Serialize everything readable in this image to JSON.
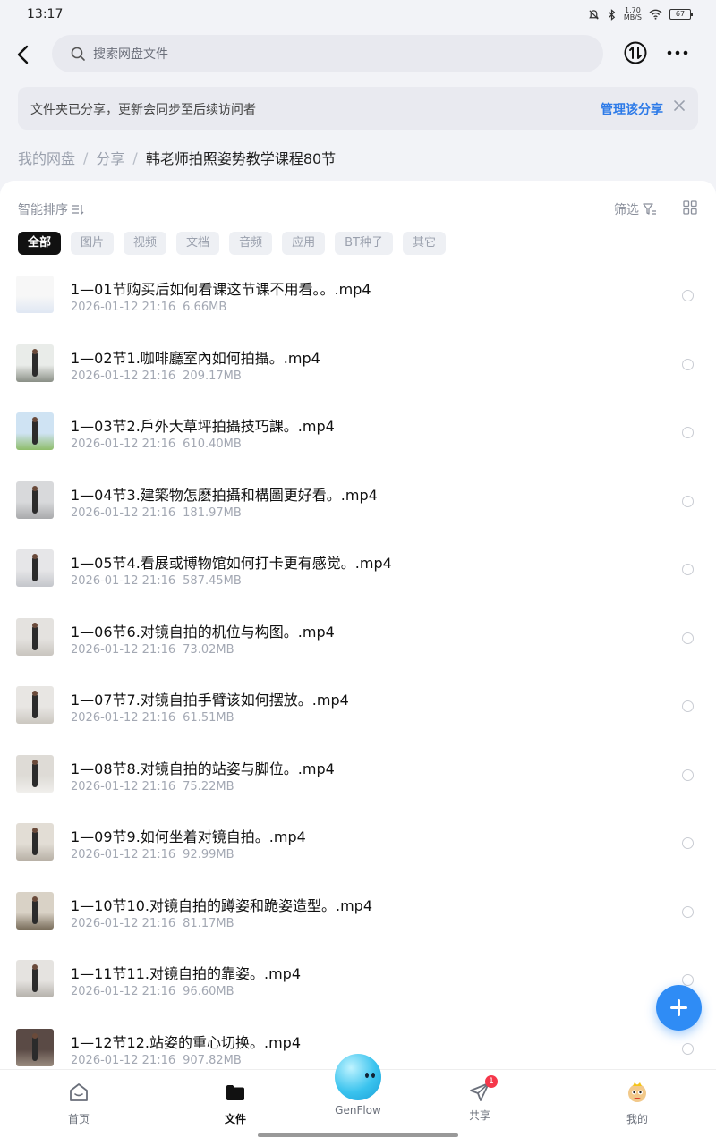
{
  "status": {
    "time": "13:17",
    "speed_value": "1.70",
    "speed_unit": "MB/S",
    "battery": "67"
  },
  "search": {
    "placeholder": "搜索网盘文件"
  },
  "notice": {
    "text": "文件夹已分享，更新会同步至后续访问者",
    "action": "管理该分享"
  },
  "breadcrumb": {
    "root": "我的网盘",
    "sep": "/",
    "parent": "分享",
    "current": "韩老师拍照姿势教学课程80节"
  },
  "toolbar": {
    "sort_label": "智能排序",
    "filter_label": "筛选"
  },
  "chips": [
    "全部",
    "图片",
    "视频",
    "文档",
    "音频",
    "应用",
    "BT种子",
    "其它"
  ],
  "files": [
    {
      "name": "1—01节购买后如何看课这节课不用看。。.mp4",
      "date": "2026-01-12  21:16",
      "size": "6.66MB"
    },
    {
      "name": "1—02节1.咖啡廳室內如何拍攝。.mp4",
      "date": "2026-01-12  21:16",
      "size": "209.17MB"
    },
    {
      "name": "1—03节2.戶外大草坪拍攝技巧課。.mp4",
      "date": "2026-01-12  21:16",
      "size": "610.40MB"
    },
    {
      "name": "1—04节3.建築物怎麽拍攝和構圖更好看。.mp4",
      "date": "2026-01-12  21:16",
      "size": "181.97MB"
    },
    {
      "name": "1—05节4.看展或博物馆如何打卡更有感觉。.mp4",
      "date": "2026-01-12  21:16",
      "size": "587.45MB"
    },
    {
      "name": "1—06节6.对镜自拍的机位与构图。.mp4",
      "date": "2026-01-12  21:16",
      "size": "73.02MB"
    },
    {
      "name": "1—07节7.对镜自拍手臂该如何摆放。.mp4",
      "date": "2026-01-12  21:16",
      "size": "61.51MB"
    },
    {
      "name": "1—08节8.对镜自拍的站姿与脚位。.mp4",
      "date": "2026-01-12  21:16",
      "size": "75.22MB"
    },
    {
      "name": "1—09节9.如何坐着对镜自拍。.mp4",
      "date": "2026-01-12  21:16",
      "size": "92.99MB"
    },
    {
      "name": "1—10节10.对镜自拍的蹲姿和跪姿造型。.mp4",
      "date": "2026-01-12  21:16",
      "size": "81.17MB"
    },
    {
      "name": "1—11节11.对镜自拍的靠姿。.mp4",
      "date": "2026-01-12  21:16",
      "size": "96.60MB"
    },
    {
      "name": "1—12节12.站姿的重心切换。.mp4",
      "date": "2026-01-12  21:16",
      "size": "907.82MB"
    }
  ],
  "nav": {
    "home": "首页",
    "files": "文件",
    "genflow": "GenFlow",
    "share": "共享",
    "share_badge": "1",
    "mine": "我的"
  },
  "colors": {
    "accent": "#2e7be8",
    "fab": "#2f8cf5",
    "badge": "#f5374a"
  }
}
